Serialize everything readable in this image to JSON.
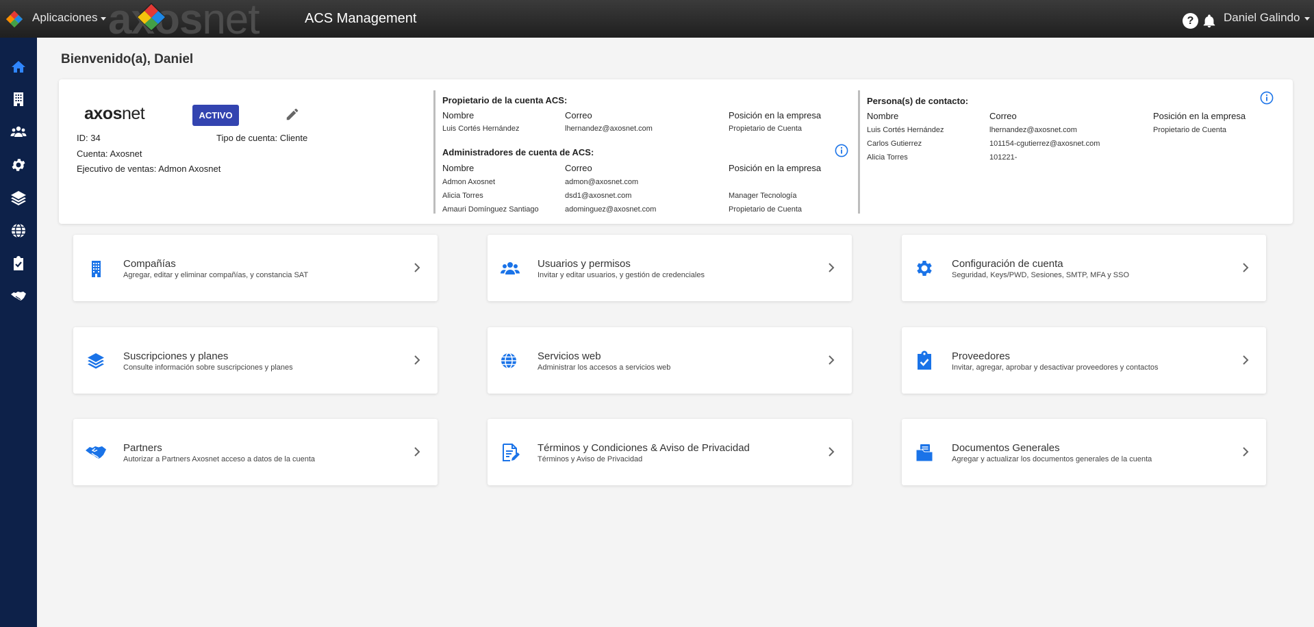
{
  "header": {
    "apps_label": "Aplicaciones",
    "brand_text_a": "axos",
    "brand_text_b": "net",
    "title": "ACS Management",
    "help_glyph": "?",
    "user_name": "Daniel Galindo"
  },
  "sidebar": {
    "items": [
      {
        "name": "home-icon",
        "active": true
      },
      {
        "name": "building-icon"
      },
      {
        "name": "users-icon"
      },
      {
        "name": "gear-icon"
      },
      {
        "name": "layers-icon"
      },
      {
        "name": "globe-icon"
      },
      {
        "name": "clipboard-check-icon"
      },
      {
        "name": "handshake-icon"
      }
    ]
  },
  "welcome": "Bienvenido(a), Daniel",
  "account": {
    "logo_a": "axos",
    "logo_b": "net",
    "status": "ACTIVO",
    "id_label": "ID:",
    "id_value": "34",
    "type_label": "Tipo de cuenta:",
    "type_value": "Cliente",
    "account_label": "Cuenta:",
    "account_value": "Axosnet",
    "exec_label": "Ejecutivo de ventas:",
    "exec_value": "Admon Axosnet"
  },
  "owner": {
    "title": "Propietario de la cuenta ACS:",
    "headers": [
      "Nombre",
      "Correo",
      "Posición en la empresa"
    ],
    "rows": [
      [
        "Luis Cortés Hernández",
        "lhernandez@axosnet.com",
        "Propietario de Cuenta"
      ]
    ]
  },
  "admins": {
    "title": "Administradores de cuenta de ACS:",
    "headers": [
      "Nombre",
      "Correo",
      "Posición en la empresa"
    ],
    "rows": [
      [
        "Admon Axosnet",
        "admon@axosnet.com",
        ""
      ],
      [
        "Alicia Torres",
        "dsd1@axosnet.com",
        "Manager Tecnología"
      ],
      [
        "Amauri Domínguez Santiago",
        "adominguez@axosnet.com",
        "Propietario de Cuenta"
      ]
    ]
  },
  "contacts": {
    "title": "Persona(s) de contacto:",
    "headers": [
      "Nombre",
      "Correo",
      "Posición en la empresa"
    ],
    "rows": [
      [
        "Luis Cortés Hernández",
        "lhernandez@axosnet.com",
        "Propietario de Cuenta"
      ],
      [
        "Carlos Gutierrez",
        "101154-cgutierrez@axosnet.com",
        ""
      ],
      [
        "Alicia Torres",
        "101221-",
        ""
      ]
    ]
  },
  "tiles": [
    {
      "icon": "building-icon",
      "title": "Compañías",
      "desc": "Agregar, editar y eliminar compañías, y constancia SAT"
    },
    {
      "icon": "users-icon",
      "title": "Usuarios y permisos",
      "desc": "Invitar y editar usuarios, y gestión de credenciales"
    },
    {
      "icon": "gear-icon",
      "title": "Configuración de cuenta",
      "desc": "Seguridad, Keys/PWD, Sesiones, SMTP, MFA y SSO"
    },
    {
      "icon": "layers-icon",
      "title": "Suscripciones y planes",
      "desc": "Consulte información sobre suscripciones y planes"
    },
    {
      "icon": "globe-icon",
      "title": "Servicios web",
      "desc": "Administrar los accesos a servicios web"
    },
    {
      "icon": "clipboard-check-icon",
      "title": "Proveedores",
      "desc": "Invitar, agregar, aprobar y desactivar proveedores y contactos"
    },
    {
      "icon": "handshake-icon",
      "title": "Partners",
      "desc": "Autorizar a Partners Axosnet acceso a datos de la cuenta"
    },
    {
      "icon": "document-edit-icon",
      "title": "Términos y Condiciones & Aviso de Privacidad",
      "desc": "Términos y Aviso de Privacidad"
    },
    {
      "icon": "folder-documents-icon",
      "title": "Documentos Generales",
      "desc": "Agregar y actualizar los documentos generales de la cuenta"
    }
  ],
  "colors": {
    "accent": "#1a73e8",
    "sidebar": "#0d2149",
    "badge": "#3344b0"
  }
}
